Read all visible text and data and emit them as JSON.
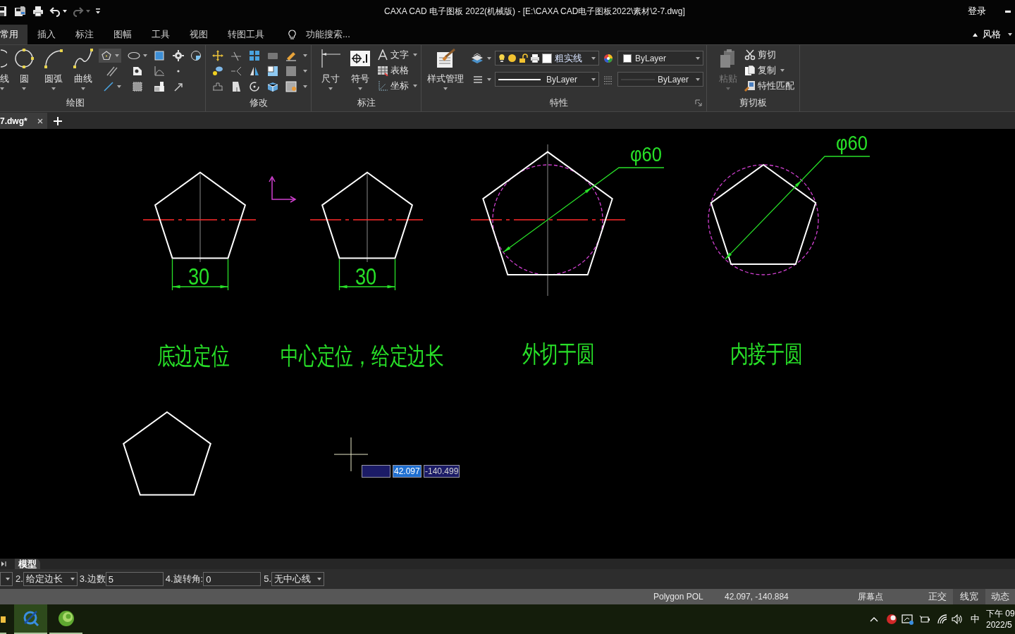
{
  "quick_access": [
    {
      "kind": "save",
      "disabled": false
    },
    {
      "kind": "save_as",
      "disabled": false
    },
    {
      "kind": "print",
      "disabled": false
    },
    {
      "kind": "undo",
      "disabled": false
    },
    {
      "kind": "redo",
      "disabled": true
    },
    {
      "kind": "customize",
      "disabled": false
    }
  ],
  "window": {
    "title": "CAXA CAD 电子图板 2022(机械版) - [E:\\CAXA CAD电子图板2022\\素材\\2-7.dwg]",
    "login": "登录"
  },
  "ribbon": {
    "tabs": [
      {
        "label": "常用",
        "selected": true
      },
      {
        "label": "插入",
        "selected": false
      },
      {
        "label": "标注",
        "selected": false
      },
      {
        "label": "图幅",
        "selected": false
      },
      {
        "label": "工具",
        "selected": false
      },
      {
        "label": "视图",
        "selected": false
      },
      {
        "label": "转图工具",
        "selected": false
      }
    ],
    "search": {
      "placeholder": "功能搜索..."
    },
    "style_menu": "风格"
  },
  "draw_group": {
    "label": "绘图",
    "large_tools": [
      {
        "kind": "line",
        "label": "线"
      },
      {
        "kind": "circle",
        "label": "圆"
      },
      {
        "kind": "arc",
        "label": "圆弧"
      },
      {
        "kind": "curve",
        "label": "曲线"
      }
    ],
    "polygon_tool": {
      "selected": true
    }
  },
  "modify_group": {
    "label": "修改"
  },
  "annotate_group": {
    "label": "标注",
    "large_tools": [
      {
        "kind": "dimension",
        "label": "尺寸"
      },
      {
        "kind": "symbol",
        "label": "符号"
      }
    ],
    "small_tools": [
      {
        "kind": "text",
        "label": "文字",
        "dropdown": true
      },
      {
        "kind": "table",
        "label": "表格",
        "dropdown": false
      },
      {
        "kind": "coordinate",
        "label": "坐标",
        "dropdown": true
      }
    ]
  },
  "properties_group": {
    "label": "特性",
    "style_manager": "样式管理",
    "layer": "粗实线",
    "color_property": "ByLayer",
    "linetype": "ByLayer",
    "lineweight": "ByLayer"
  },
  "clipboard_group": {
    "label": "剪切板",
    "paste": {
      "label": "粘贴",
      "disabled": true
    },
    "small_tools": [
      {
        "kind": "cut",
        "label": "剪切",
        "dropdown": false
      },
      {
        "kind": "copy",
        "label": "复制",
        "dropdown": true
      },
      {
        "kind": "match",
        "label": "特性匹配",
        "dropdown": false
      }
    ]
  },
  "document_tabs": [
    {
      "label": "7.dwg*",
      "selected": true
    }
  ],
  "drawing": {
    "figures": [
      {
        "kind": "bottom_edge",
        "dimension": "30",
        "caption": "底边定位"
      },
      {
        "kind": "center_side",
        "dimension": "30",
        "caption": "中心定位，给定边长"
      },
      {
        "kind": "circumscribed",
        "dimension": "φ60",
        "caption": "外切于圆"
      },
      {
        "kind": "inscribed",
        "dimension": "φ60",
        "caption": "内接于圆"
      },
      {
        "kind": "plain"
      }
    ],
    "dynamic_input": [
      {
        "selected": false
      },
      {
        "value": "42.097",
        "selected": true
      },
      {
        "value": "-140.499",
        "selected": false
      }
    ]
  },
  "layout_tabs": [
    {
      "label": "模型",
      "selected": true
    }
  ],
  "command_bar": {
    "fields": [
      {
        "kind": "dropdown"
      },
      {
        "kind": "dropdown",
        "label": "2.",
        "value": "给定边长"
      },
      {
        "kind": "input",
        "label": "3.边数",
        "value": "5"
      },
      {
        "kind": "input",
        "label": "4.旋转角:",
        "value": "0"
      },
      {
        "kind": "dropdown",
        "label": "5.",
        "value": "无中心线"
      }
    ]
  },
  "status_bar": {
    "command": "Polygon POL",
    "coordinates": "42.097, -140.884",
    "snap_mode": "屏幕点",
    "toggles": [
      {
        "label": "正交",
        "on": false
      },
      {
        "label": "线宽",
        "on": true
      },
      {
        "label": "动态",
        "on": false
      }
    ]
  },
  "taskbar": {
    "apps": [
      {
        "kind": "folder",
        "selected": false
      },
      {
        "kind": "caxa",
        "selected": true
      },
      {
        "kind": "orb",
        "selected": false
      }
    ],
    "tray": {
      "input_method": "中",
      "time": "下午 09",
      "date": "2022/5"
    }
  }
}
